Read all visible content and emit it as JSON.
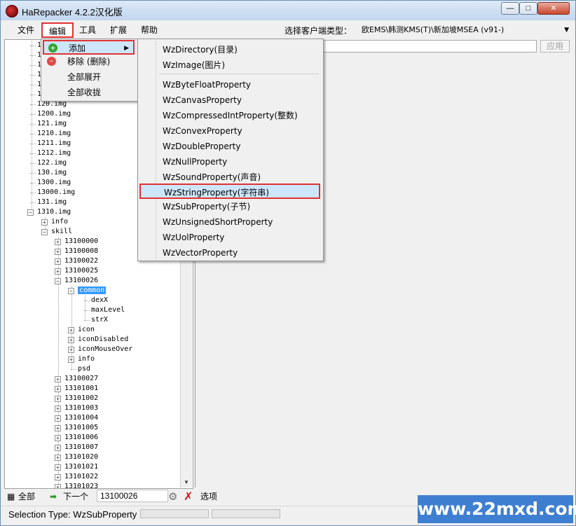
{
  "window": {
    "title": "HaRepacker 4.2.2汉化版"
  },
  "menubar": {
    "items": [
      "文件",
      "编辑",
      "工具",
      "扩展",
      "帮助"
    ],
    "client_label": "选择客户端类型：",
    "client_value": "欧EMS\\韩测KMS(T)\\新加坡MSEA (v91-)"
  },
  "edit_menu": {
    "items": [
      {
        "label": "添加",
        "icon": "add-icon"
      },
      {
        "label": "移除 (删除)",
        "icon": "remove-icon"
      },
      {
        "label": "全部展开"
      },
      {
        "label": "全部收拢"
      }
    ]
  },
  "add_submenu": {
    "items": [
      "WzDirectory(目录)",
      "WzImage(图片)",
      "WzByteFloatProperty",
      "WzCanvasProperty",
      "WzCompressedIntProperty(整数)",
      "WzConvexProperty",
      "WzDoubleProperty",
      "WzNullProperty",
      "WzSoundProperty(声音)",
      "WzStringProperty(字符串)",
      "WzSubProperty(子节)",
      "WzUnsignedShortProperty",
      "WzUolProperty",
      "WzVectorProperty"
    ],
    "highlighted": "WzStringProperty(字符串)"
  },
  "tree": {
    "partial_top": [
      "1",
      "1",
      "1",
      "1",
      "1",
      "1"
    ],
    "img_nodes": [
      "120.img",
      "1200.img",
      "121.img",
      "1210.img",
      "1211.img",
      "1212.img",
      "122.img",
      "130.img",
      "1300.img",
      "13000.img",
      "131.img",
      "1310.img"
    ],
    "level1": [
      "info",
      "skill"
    ],
    "skill_before": [
      "13100000",
      "13100008",
      "13100022",
      "13100025",
      "13100026"
    ],
    "common": "common",
    "common_children": [
      "dexX",
      "maxLevel",
      "strX"
    ],
    "skill26_rest": [
      "icon",
      "iconDisabled",
      "iconMouseOver",
      "info",
      "psd"
    ],
    "skill_after": [
      "13100027",
      "13101001",
      "13101002",
      "13101003",
      "13101004",
      "13101005",
      "13101006",
      "13101007",
      "13101020",
      "13101021",
      "13101022",
      "13101023"
    ]
  },
  "property_panel": {
    "apply_label": "应用"
  },
  "searchbar": {
    "all_label": "全部",
    "next_label": "下一个",
    "search_value": "13100026",
    "options_label": "选项"
  },
  "statusbar": {
    "text": "Selection Type: WzSubProperty"
  },
  "watermark": "www.22mxd.com"
}
